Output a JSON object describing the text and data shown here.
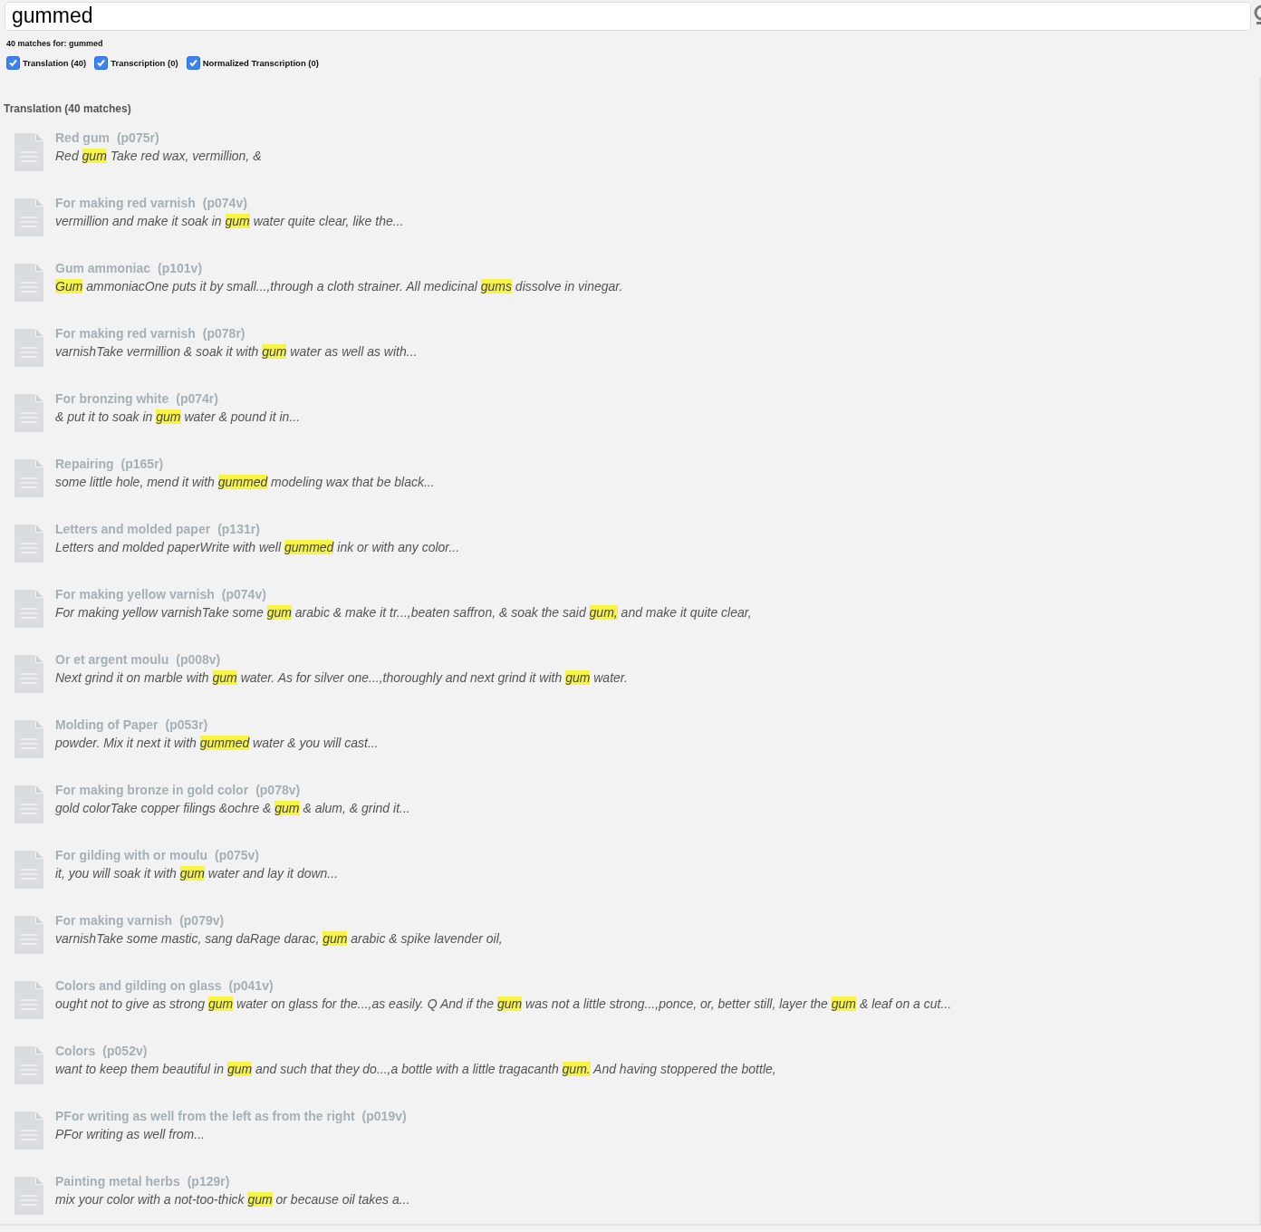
{
  "search": {
    "value": "gummed"
  },
  "summary": "40 matches for: gummed",
  "filters": [
    {
      "label": "Translation (40)",
      "checked": true
    },
    {
      "label": "Transcription (0)",
      "checked": true
    },
    {
      "label": "Normalized Transcription (0)",
      "checked": true
    }
  ],
  "section": {
    "heading": "Translation (40 matches)",
    "results": [
      {
        "title": "Red gum",
        "page": "(p075r)",
        "snippet": [
          {
            "text": "Red ",
            "highlight": false
          },
          {
            "text": "gum",
            "highlight": true
          },
          {
            "text": " Take red wax, vermillion, &",
            "highlight": false
          }
        ]
      },
      {
        "title": "For making red varnish",
        "page": "(p074v)",
        "snippet": [
          {
            "text": "vermillion and make it soak in ",
            "highlight": false
          },
          {
            "text": "gum",
            "highlight": true
          },
          {
            "text": " water quite clear, like the...",
            "highlight": false
          }
        ]
      },
      {
        "title": "Gum ammoniac",
        "page": "(p101v)",
        "snippet": [
          {
            "text": "Gum",
            "highlight": true
          },
          {
            "text": " ammoniacOne puts it by small...,through a cloth strainer. All medicinal ",
            "highlight": false
          },
          {
            "text": "gums",
            "highlight": true
          },
          {
            "text": " dissolve in vinegar.",
            "highlight": false
          }
        ]
      },
      {
        "title": "For making red varnish",
        "page": "(p078r)",
        "snippet": [
          {
            "text": "varnishTake vermillion & soak it with ",
            "highlight": false
          },
          {
            "text": "gum",
            "highlight": true
          },
          {
            "text": " water as well as with...",
            "highlight": false
          }
        ]
      },
      {
        "title": "For bronzing white",
        "page": "(p074r)",
        "snippet": [
          {
            "text": "& put it to soak in ",
            "highlight": false
          },
          {
            "text": "gum",
            "highlight": true
          },
          {
            "text": " water & pound it in...",
            "highlight": false
          }
        ]
      },
      {
        "title": "Repairing",
        "page": "(p165r)",
        "snippet": [
          {
            "text": "some little hole, mend it with ",
            "highlight": false
          },
          {
            "text": "gummed",
            "highlight": true
          },
          {
            "text": " modeling wax that be black...",
            "highlight": false
          }
        ]
      },
      {
        "title": "Letters and molded paper",
        "page": "(p131r)",
        "snippet": [
          {
            "text": "Letters and molded paperWrite with well ",
            "highlight": false
          },
          {
            "text": "gummed",
            "highlight": true
          },
          {
            "text": " ink or with any color...",
            "highlight": false
          }
        ]
      },
      {
        "title": "For making yellow varnish",
        "page": "(p074v)",
        "snippet": [
          {
            "text": "For making yellow varnishTake some ",
            "highlight": false
          },
          {
            "text": "gum",
            "highlight": true
          },
          {
            "text": " arabic & make it tr...,beaten saffron, & soak the said ",
            "highlight": false
          },
          {
            "text": "gum,",
            "highlight": true
          },
          {
            "text": " and make it quite clear,",
            "highlight": false
          }
        ]
      },
      {
        "title": "Or et argent moulu",
        "page": "(p008v)",
        "snippet": [
          {
            "text": "Next grind it on marble with ",
            "highlight": false
          },
          {
            "text": "gum",
            "highlight": true
          },
          {
            "text": " water. As for silver one...,thoroughly and next grind it with ",
            "highlight": false
          },
          {
            "text": "gum",
            "highlight": true
          },
          {
            "text": " water.",
            "highlight": false
          }
        ]
      },
      {
        "title": "Molding of Paper",
        "page": "(p053r)",
        "snippet": [
          {
            "text": "powder. Mix it next it with ",
            "highlight": false
          },
          {
            "text": "gummed",
            "highlight": true
          },
          {
            "text": " water & you will cast...",
            "highlight": false
          }
        ]
      },
      {
        "title": "For making bronze in gold color",
        "page": "(p078v)",
        "snippet": [
          {
            "text": "gold colorTake copper filings &ochre & ",
            "highlight": false
          },
          {
            "text": "gum",
            "highlight": true
          },
          {
            "text": " & alum, & grind it...",
            "highlight": false
          }
        ]
      },
      {
        "title": "For gilding with or moulu",
        "page": "(p075v)",
        "snippet": [
          {
            "text": "it, you will soak it with ",
            "highlight": false
          },
          {
            "text": "gum",
            "highlight": true
          },
          {
            "text": " water and lay it down...",
            "highlight": false
          }
        ]
      },
      {
        "title": "For making varnish",
        "page": "(p079v)",
        "snippet": [
          {
            "text": "varnishTake some mastic, sang daRage darac, ",
            "highlight": false
          },
          {
            "text": "gum",
            "highlight": true
          },
          {
            "text": " arabic & spike lavender oil,",
            "highlight": false
          }
        ]
      },
      {
        "title": "Colors and gilding on glass",
        "page": "(p041v)",
        "snippet": [
          {
            "text": "ought not to give as strong ",
            "highlight": false
          },
          {
            "text": "gum",
            "highlight": true
          },
          {
            "text": " water on glass for the...,as easily. Q And if the ",
            "highlight": false
          },
          {
            "text": "gum",
            "highlight": true
          },
          {
            "text": " was not a little strong...,ponce, or, better still, layer the ",
            "highlight": false
          },
          {
            "text": "gum",
            "highlight": true
          },
          {
            "text": " & leaf on a cut...",
            "highlight": false
          }
        ]
      },
      {
        "title": "Colors",
        "page": "(p052v)",
        "snippet": [
          {
            "text": "want to keep them beautiful in ",
            "highlight": false
          },
          {
            "text": "gum",
            "highlight": true
          },
          {
            "text": " and such that they do...,a bottle with a little tragacanth ",
            "highlight": false
          },
          {
            "text": "gum.",
            "highlight": true
          },
          {
            "text": " And having stoppered the bottle,",
            "highlight": false
          }
        ]
      },
      {
        "title": "PFor writing as well from the left as from the right",
        "page": "(p019v)",
        "snippet": [
          {
            "text": "PFor writing as well from...",
            "highlight": false
          }
        ]
      },
      {
        "title": "Painting metal herbs",
        "page": "(p129r)",
        "snippet": [
          {
            "text": "mix your color with a not-too-thick ",
            "highlight": false
          },
          {
            "text": "gum",
            "highlight": true
          },
          {
            "text": " or because oil takes a...",
            "highlight": false
          }
        ]
      }
    ]
  }
}
